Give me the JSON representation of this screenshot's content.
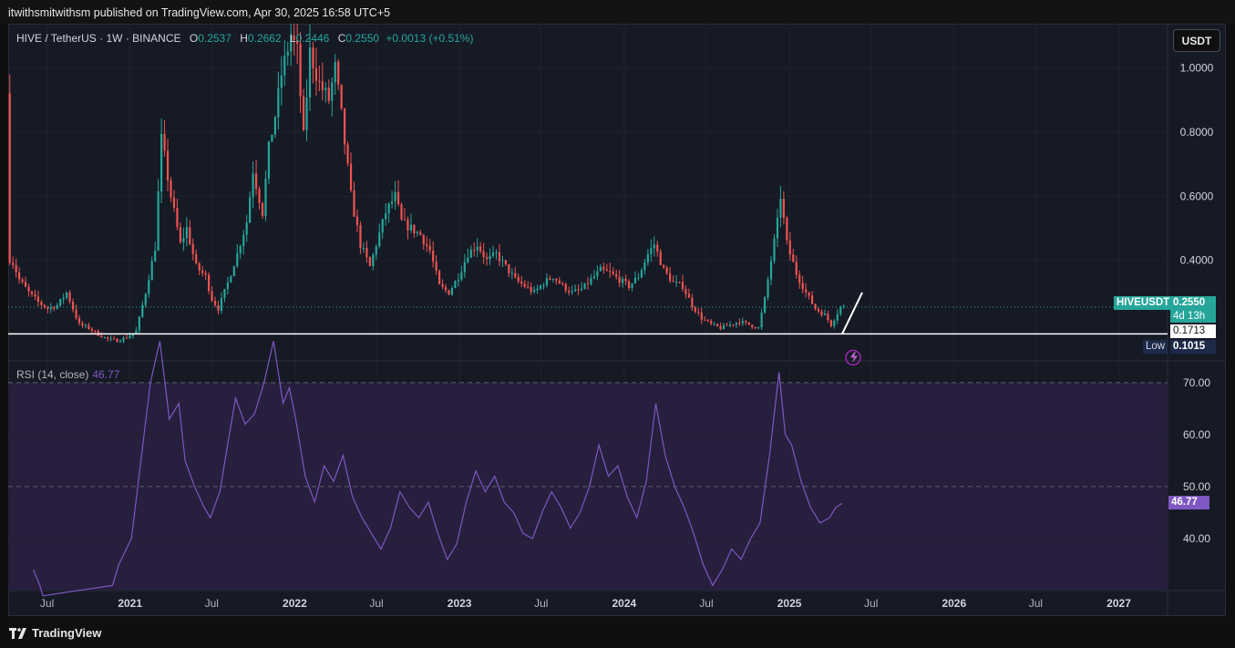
{
  "header": {
    "publish_line": "itwithsmitwithsm published on TradingView.com, Apr 30, 2025 16:58 UTC+5"
  },
  "legend": {
    "symbol": "HIVE / TetherUS · 1W · BINANCE",
    "open_label": "O",
    "open": "0.2537",
    "high_label": "H",
    "high": "0.2662",
    "low_label": "L",
    "low": "0.2446",
    "close_label": "C",
    "close": "0.2550",
    "change": "+0.0013 (+0.51%)"
  },
  "currency_button": "USDT",
  "price_badges": {
    "symbol_tag": "HIVEUSDT",
    "last_price": "0.2550",
    "countdown": "4d 13h",
    "hline_price": "0.1713",
    "low_label": "Low",
    "low_price": "0.1015",
    "rsi_value": "46.77"
  },
  "rsi_legend": {
    "label": "RSI (14, close)",
    "value": "46.77"
  },
  "footer": {
    "brand": "TradingView"
  },
  "colors": {
    "up": "#26a69a",
    "down": "#ef5350",
    "rsi_line": "#7e57c2",
    "rsi_band": "#271f3d",
    "background": "#161a25",
    "price_line": "#26a69a"
  },
  "chart_data": [
    {
      "type": "candlestick",
      "title": "HIVE / TetherUS · 1W · BINANCE",
      "y_axis_ticks": [
        "0.4000",
        "0.6000",
        "0.8000",
        "1.0000"
      ],
      "x_axis_ticks": [
        "Jul",
        "2021",
        "Jul",
        "2022",
        "Jul",
        "2023",
        "Jul",
        "2024",
        "Jul",
        "2025",
        "Jul",
        "2026",
        "Jul",
        "2027"
      ],
      "x_range": [
        "2020-04-06",
        "2027-04-19"
      ],
      "y_range": [
        0.09,
        1.12
      ],
      "last_close": 0.255,
      "horizontal_line": 0.1713,
      "period_low": 0.1015,
      "series_path": [
        [
          "2020-04-06",
          0.92
        ],
        [
          "2020-04-13",
          0.42
        ],
        [
          "2020-05-04",
          0.34
        ],
        [
          "2020-05-25",
          0.3
        ],
        [
          "2020-06-15",
          0.27
        ],
        [
          "2020-07-06",
          0.25
        ],
        [
          "2020-07-27",
          0.26
        ],
        [
          "2020-08-17",
          0.3
        ],
        [
          "2020-08-31",
          0.25
        ],
        [
          "2020-09-14",
          0.2
        ],
        [
          "2020-10-05",
          0.19
        ],
        [
          "2020-10-26",
          0.17
        ],
        [
          "2020-11-16",
          0.155
        ],
        [
          "2020-12-07",
          0.15
        ],
        [
          "2020-12-28",
          0.16
        ],
        [
          "2021-01-18",
          0.18
        ],
        [
          "2021-02-08",
          0.3
        ],
        [
          "2021-03-01",
          0.44
        ],
        [
          "2021-03-15",
          0.78
        ],
        [
          "2021-04-05",
          0.6
        ],
        [
          "2021-04-26",
          0.45
        ],
        [
          "2021-05-10",
          0.5
        ],
        [
          "2021-05-31",
          0.38
        ],
        [
          "2021-06-21",
          0.35
        ],
        [
          "2021-07-05",
          0.28
        ],
        [
          "2021-07-19",
          0.25
        ],
        [
          "2021-08-09",
          0.33
        ],
        [
          "2021-08-30",
          0.42
        ],
        [
          "2021-09-20",
          0.52
        ],
        [
          "2021-10-04",
          0.68
        ],
        [
          "2021-10-25",
          0.55
        ],
        [
          "2021-11-08",
          0.75
        ],
        [
          "2021-11-22",
          0.85
        ],
        [
          "2021-12-06",
          0.98
        ],
        [
          "2021-12-27",
          1.1
        ],
        [
          "2022-01-10",
          1.05
        ],
        [
          "2022-01-24",
          0.78
        ],
        [
          "2022-02-07",
          1.05
        ],
        [
          "2022-02-28",
          0.95
        ],
        [
          "2022-03-21",
          0.9
        ],
        [
          "2022-04-04",
          1.0
        ],
        [
          "2022-04-18",
          0.85
        ],
        [
          "2022-05-09",
          0.6
        ],
        [
          "2022-05-30",
          0.45
        ],
        [
          "2022-06-20",
          0.38
        ],
        [
          "2022-07-04",
          0.45
        ],
        [
          "2022-07-25",
          0.55
        ],
        [
          "2022-08-15",
          0.6
        ],
        [
          "2022-08-29",
          0.52
        ],
        [
          "2022-09-19",
          0.5
        ],
        [
          "2022-10-10",
          0.48
        ],
        [
          "2022-10-31",
          0.43
        ],
        [
          "2022-11-21",
          0.32
        ],
        [
          "2022-12-12",
          0.3
        ],
        [
          "2023-01-02",
          0.35
        ],
        [
          "2023-01-23",
          0.42
        ],
        [
          "2023-02-13",
          0.45
        ],
        [
          "2023-03-06",
          0.4
        ],
        [
          "2023-03-27",
          0.42
        ],
        [
          "2023-04-17",
          0.38
        ],
        [
          "2023-05-08",
          0.34
        ],
        [
          "2023-05-29",
          0.32
        ],
        [
          "2023-06-19",
          0.3
        ],
        [
          "2023-07-10",
          0.33
        ],
        [
          "2023-07-31",
          0.35
        ],
        [
          "2023-08-21",
          0.32
        ],
        [
          "2023-09-11",
          0.3
        ],
        [
          "2023-10-02",
          0.31
        ],
        [
          "2023-10-23",
          0.34
        ],
        [
          "2023-11-13",
          0.37
        ],
        [
          "2023-12-04",
          0.36
        ],
        [
          "2023-12-25",
          0.34
        ],
        [
          "2024-01-15",
          0.32
        ],
        [
          "2024-02-05",
          0.35
        ],
        [
          "2024-02-26",
          0.42
        ],
        [
          "2024-03-11",
          0.45
        ],
        [
          "2024-04-01",
          0.37
        ],
        [
          "2024-04-22",
          0.33
        ],
        [
          "2024-05-13",
          0.32
        ],
        [
          "2024-06-03",
          0.26
        ],
        [
          "2024-06-24",
          0.22
        ],
        [
          "2024-07-15",
          0.2
        ],
        [
          "2024-08-05",
          0.19
        ],
        [
          "2024-08-26",
          0.2
        ],
        [
          "2024-09-16",
          0.21
        ],
        [
          "2024-10-07",
          0.2
        ],
        [
          "2024-10-28",
          0.19
        ],
        [
          "2024-11-11",
          0.28
        ],
        [
          "2024-11-25",
          0.4
        ],
        [
          "2024-12-09",
          0.52
        ],
        [
          "2024-12-16",
          0.6
        ],
        [
          "2024-12-30",
          0.45
        ],
        [
          "2025-01-20",
          0.36
        ],
        [
          "2025-02-10",
          0.3
        ],
        [
          "2025-03-03",
          0.25
        ],
        [
          "2025-03-24",
          0.23
        ],
        [
          "2025-04-07",
          0.2
        ],
        [
          "2025-04-28",
          0.255
        ]
      ]
    },
    {
      "type": "line",
      "title": "RSI (14, close)",
      "y_axis_ticks": [
        "40.00",
        "50.00",
        "60.00",
        "70.00"
      ],
      "y_range": [
        30,
        74
      ],
      "last_value": 46.77,
      "series": [
        {
          "name": "RSI (14, close)",
          "points": [
            [
              "2020-06-01",
              34
            ],
            [
              "2020-06-15",
              31
            ],
            [
              "2020-06-22",
              29
            ],
            [
              "2020-11-23",
              31
            ],
            [
              "2020-12-07",
              35
            ],
            [
              "2021-01-04",
              40
            ],
            [
              "2021-01-25",
              55
            ],
            [
              "2021-02-15",
              70
            ],
            [
              "2021-03-08",
              78
            ],
            [
              "2021-03-29",
              63
            ],
            [
              "2021-04-19",
              66
            ],
            [
              "2021-05-03",
              55
            ],
            [
              "2021-05-24",
              50
            ],
            [
              "2021-06-14",
              46
            ],
            [
              "2021-06-28",
              44
            ],
            [
              "2021-07-19",
              49
            ],
            [
              "2021-08-09",
              60
            ],
            [
              "2021-08-23",
              67
            ],
            [
              "2021-09-13",
              62
            ],
            [
              "2021-10-04",
              64
            ],
            [
              "2021-10-25",
              70
            ],
            [
              "2021-11-15",
              78
            ],
            [
              "2021-12-06",
              66
            ],
            [
              "2021-12-20",
              69
            ],
            [
              "2022-01-03",
              63
            ],
            [
              "2022-01-24",
              52
            ],
            [
              "2022-02-14",
              47
            ],
            [
              "2022-03-07",
              54
            ],
            [
              "2022-03-28",
              51
            ],
            [
              "2022-04-18",
              56
            ],
            [
              "2022-05-09",
              48
            ],
            [
              "2022-05-30",
              44
            ],
            [
              "2022-06-20",
              41
            ],
            [
              "2022-07-11",
              38
            ],
            [
              "2022-08-01",
              42
            ],
            [
              "2022-08-22",
              49
            ],
            [
              "2022-09-12",
              46
            ],
            [
              "2022-10-03",
              44
            ],
            [
              "2022-10-24",
              47
            ],
            [
              "2022-11-14",
              41
            ],
            [
              "2022-12-05",
              36
            ],
            [
              "2022-12-26",
              39
            ],
            [
              "2023-01-16",
              47
            ],
            [
              "2023-02-06",
              53
            ],
            [
              "2023-02-27",
              49
            ],
            [
              "2023-03-20",
              52
            ],
            [
              "2023-04-10",
              47
            ],
            [
              "2023-05-01",
              45
            ],
            [
              "2023-05-22",
              41
            ],
            [
              "2023-06-12",
              40
            ],
            [
              "2023-07-03",
              45
            ],
            [
              "2023-07-24",
              49
            ],
            [
              "2023-08-14",
              46
            ],
            [
              "2023-09-04",
              42
            ],
            [
              "2023-09-25",
              45
            ],
            [
              "2023-10-16",
              50
            ],
            [
              "2023-11-06",
              58
            ],
            [
              "2023-11-27",
              52
            ],
            [
              "2023-12-18",
              54
            ],
            [
              "2024-01-08",
              48
            ],
            [
              "2024-01-29",
              44
            ],
            [
              "2024-02-19",
              51
            ],
            [
              "2024-03-11",
              66
            ],
            [
              "2024-04-01",
              56
            ],
            [
              "2024-04-22",
              50
            ],
            [
              "2024-05-13",
              46
            ],
            [
              "2024-06-03",
              41
            ],
            [
              "2024-06-24",
              35
            ],
            [
              "2024-07-15",
              31
            ],
            [
              "2024-08-05",
              34
            ],
            [
              "2024-08-26",
              38
            ],
            [
              "2024-09-16",
              36
            ],
            [
              "2024-10-07",
              40
            ],
            [
              "2024-10-28",
              43
            ],
            [
              "2024-11-18",
              56
            ],
            [
              "2024-12-09",
              72
            ],
            [
              "2024-12-23",
              60
            ],
            [
              "2025-01-06",
              58
            ],
            [
              "2025-01-27",
              51
            ],
            [
              "2025-02-17",
              46
            ],
            [
              "2025-03-10",
              43
            ],
            [
              "2025-03-31",
              44
            ],
            [
              "2025-04-14",
              46
            ],
            [
              "2025-04-28",
              46.77
            ]
          ]
        }
      ]
    }
  ]
}
